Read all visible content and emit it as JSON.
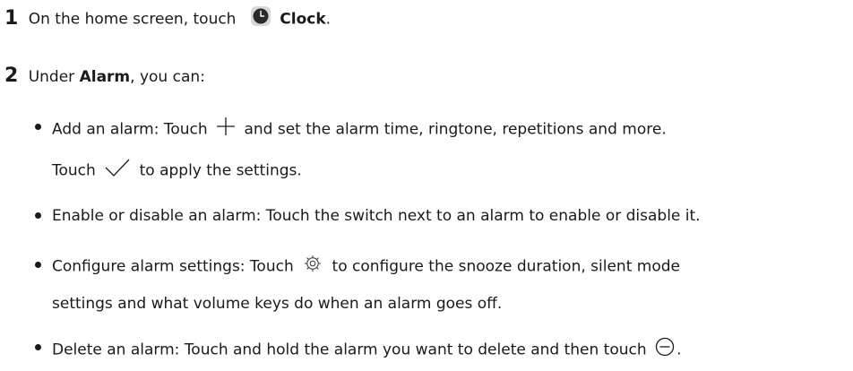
{
  "step1": {
    "number": "1",
    "text_before": "On the home screen, touch",
    "app_name": "Clock",
    "end": "."
  },
  "step2": {
    "number": "2",
    "text_before": "Under",
    "tab_name": "Alarm",
    "text_after": ", you can:"
  },
  "bullets": {
    "add_a": "Add an alarm: Touch",
    "add_b": "and set the alarm time, ringtone, repetitions and more.",
    "add_c": "Touch",
    "add_d": "to apply the settings.",
    "enable": "Enable or disable an alarm: Touch the switch next to an alarm to enable or disable it.",
    "config_a": "Configure alarm settings: Touch",
    "config_b": "to configure the snooze duration, silent mode",
    "config_c": "settings and what volume keys do when an alarm goes off.",
    "delete_a": "Delete an alarm: Touch and hold the alarm you want to delete and then touch",
    "delete_end": "."
  },
  "icons": [
    "clock-app-icon",
    "plus-icon",
    "checkmark-icon",
    "gear-icon",
    "minus-circle-icon"
  ]
}
